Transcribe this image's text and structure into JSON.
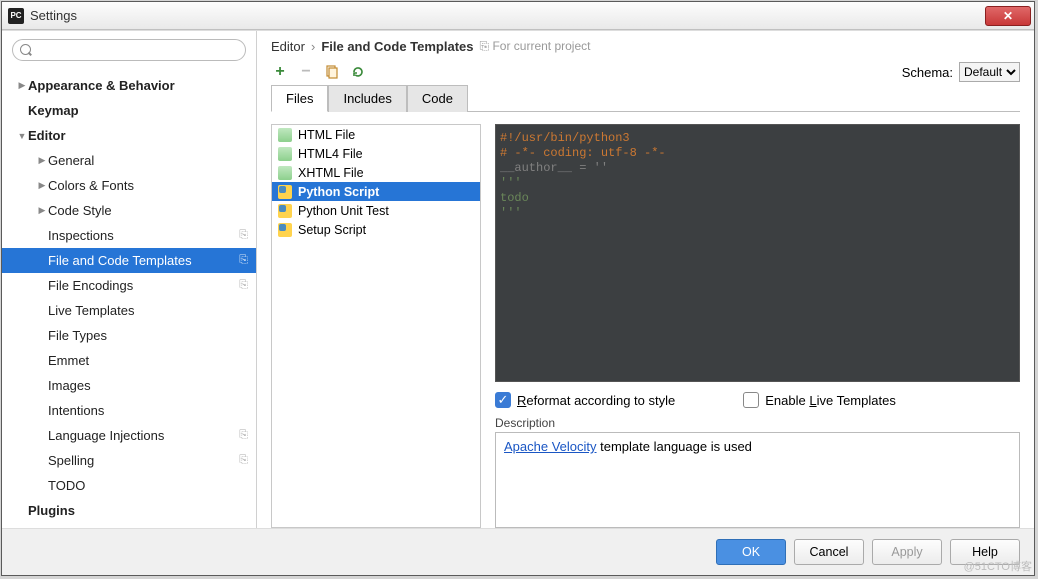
{
  "window": {
    "title": "Settings",
    "app_icon_text": "PC"
  },
  "search": {
    "placeholder": ""
  },
  "tree": [
    {
      "label": "Appearance & Behavior",
      "bold": true,
      "level": 0,
      "arrow": "▶"
    },
    {
      "label": "Keymap",
      "bold": true,
      "level": 0,
      "arrow": ""
    },
    {
      "label": "Editor",
      "bold": true,
      "level": 0,
      "arrow": "▼"
    },
    {
      "label": "General",
      "bold": false,
      "level": 1,
      "arrow": "▶"
    },
    {
      "label": "Colors & Fonts",
      "bold": false,
      "level": 1,
      "arrow": "▶"
    },
    {
      "label": "Code Style",
      "bold": false,
      "level": 1,
      "arrow": "▶"
    },
    {
      "label": "Inspections",
      "bold": false,
      "level": 1,
      "arrow": "",
      "copy": true
    },
    {
      "label": "File and Code Templates",
      "bold": false,
      "level": 1,
      "arrow": "",
      "copy": true,
      "selected": true
    },
    {
      "label": "File Encodings",
      "bold": false,
      "level": 1,
      "arrow": "",
      "copy": true
    },
    {
      "label": "Live Templates",
      "bold": false,
      "level": 1,
      "arrow": ""
    },
    {
      "label": "File Types",
      "bold": false,
      "level": 1,
      "arrow": ""
    },
    {
      "label": "Emmet",
      "bold": false,
      "level": 1,
      "arrow": ""
    },
    {
      "label": "Images",
      "bold": false,
      "level": 1,
      "arrow": ""
    },
    {
      "label": "Intentions",
      "bold": false,
      "level": 1,
      "arrow": ""
    },
    {
      "label": "Language Injections",
      "bold": false,
      "level": 1,
      "arrow": "",
      "copy": true
    },
    {
      "label": "Spelling",
      "bold": false,
      "level": 1,
      "arrow": "",
      "copy": true
    },
    {
      "label": "TODO",
      "bold": false,
      "level": 1,
      "arrow": ""
    },
    {
      "label": "Plugins",
      "bold": true,
      "level": 0,
      "arrow": ""
    }
  ],
  "breadcrumb": {
    "part1": "Editor",
    "sep": "›",
    "part2": "File and Code Templates",
    "scope": "For current project"
  },
  "schema": {
    "label": "Schema:",
    "value": "Default"
  },
  "tabs": [
    {
      "label": "Files",
      "active": true
    },
    {
      "label": "Includes",
      "active": false
    },
    {
      "label": "Code",
      "active": false
    }
  ],
  "templates": [
    {
      "label": "HTML File",
      "icon": "html"
    },
    {
      "label": "HTML4 File",
      "icon": "html"
    },
    {
      "label": "XHTML File",
      "icon": "html"
    },
    {
      "label": "Python Script",
      "icon": "py",
      "selected": true
    },
    {
      "label": "Python Unit Test",
      "icon": "py"
    },
    {
      "label": "Setup Script",
      "icon": "py"
    }
  ],
  "code": {
    "l1": "#!/usr/bin/python3",
    "l2": "# -*- coding: utf-8 -*-",
    "l3": "",
    "l4": "__author__ = ''",
    "l5": "",
    "l6": "'''",
    "l7": "todo",
    "l8": "'''"
  },
  "checks": {
    "reformat_label": "Reformat according to style",
    "reformat_checked": true,
    "livetpl_label": "Enable Live Templates",
    "livetpl_checked": false
  },
  "description": {
    "label": "Description",
    "link_text": "Apache Velocity",
    "rest": " template language is used"
  },
  "footer": {
    "ok": "OK",
    "cancel": "Cancel",
    "apply": "Apply",
    "help": "Help"
  },
  "watermark": "@51CTO博客"
}
